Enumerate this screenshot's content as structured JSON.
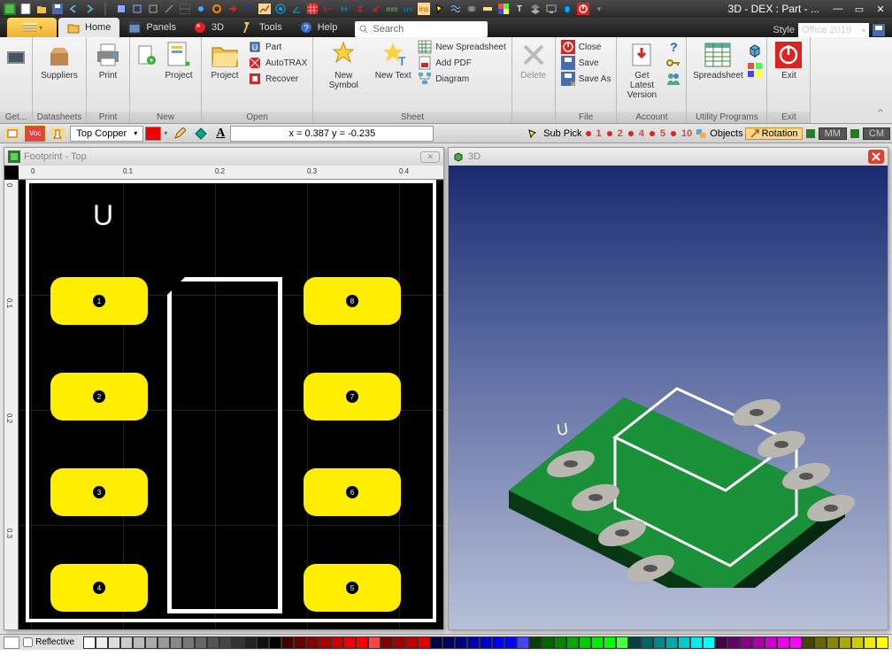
{
  "title": "3D - DEX : Part - ...",
  "tabs": {
    "home": "Home",
    "panels": "Panels",
    "threeD": "3D",
    "tools": "Tools",
    "help": "Help"
  },
  "search_placeholder": "Search",
  "style_label": "Style",
  "style_value": "Office 2019",
  "ribbon": {
    "get": "Get...",
    "suppliers": "Suppliers",
    "datasheets": "Datasheets",
    "print": "Print",
    "print_grp": "Print",
    "project_new": "Project",
    "new_grp": "New",
    "project_open": "Project",
    "part": "Part",
    "autotrax": "AutoTRAX",
    "recover": "Recover",
    "open_grp": "Open",
    "new_symbol": "New Symbol",
    "new_text": "New Text",
    "new_spreadsheet": "New Spreadsheet",
    "add_pdf": "Add PDF",
    "diagram": "Diagram",
    "sheet_grp": "Sheet",
    "delete": "Delete",
    "close": "Close",
    "save": "Save",
    "save_as": "Save As",
    "file_grp": "File",
    "get_latest": "Get Latest Version",
    "account_grp": "Account",
    "spreadsheet": "Spreadsheet",
    "utility_grp": "Utility Programs",
    "exit": "Exit",
    "exit_grp": "Exit"
  },
  "toolbar2": {
    "layer": "Top Copper",
    "coords": "x = 0.387 y = -0.235",
    "subpick": "Sub Pick",
    "n1": "1",
    "n2": "2",
    "n4": "4",
    "n5": "5",
    "n10": "10",
    "objects": "Objects",
    "rotation": "Rotation",
    "mm": "MM",
    "cm": "CM"
  },
  "panels": {
    "footprint_title": "Footprint - Top",
    "threeD_title": "3D",
    "ref": "U",
    "ruler_h": [
      "0",
      "0.1",
      "0.2",
      "0.3",
      "0.4"
    ],
    "ruler_v": [
      "0",
      "0.1",
      "0.2",
      "0.3"
    ],
    "pads": [
      "1",
      "2",
      "3",
      "4",
      "5",
      "6",
      "7",
      "8"
    ]
  },
  "colorbar": {
    "reflective": "Reflective"
  }
}
